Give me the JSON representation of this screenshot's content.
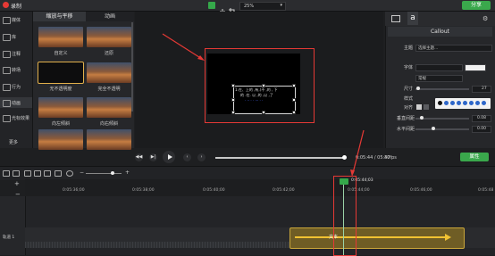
{
  "app": {
    "record_label": "录制",
    "share_label": "分享",
    "zoom": "25%"
  },
  "tools_rail": [
    {
      "label": "媒体",
      "icon": "media-icon"
    },
    {
      "label": "库",
      "icon": "library-icon"
    },
    {
      "label": "注释",
      "icon": "annotation-icon"
    },
    {
      "label": "转场",
      "icon": "transition-icon"
    },
    {
      "label": "行为",
      "icon": "behavior-icon"
    },
    {
      "label": "动画",
      "icon": "animation-icon"
    },
    {
      "label": "光标效果",
      "icon": "cursor-effect-icon"
    },
    {
      "label": "更多",
      "icon": "more-icon"
    }
  ],
  "gallery": {
    "tabs": [
      "缩放与平移",
      "动画"
    ],
    "items": [
      {
        "label": "自定义"
      },
      {
        "label": "还原"
      },
      {
        "label": "无不透明度"
      },
      {
        "label": "完全不透明"
      },
      {
        "label": "向左倾斜"
      },
      {
        "label": "向右倾斜"
      },
      {
        "label": ""
      },
      {
        "label": ""
      }
    ]
  },
  "canvas": {
    "callout_line1": "1.在、上的 ,有,(不 ,的 , 下",
    "callout_line2": "的 .在. 以 ,的 ,以 ,了",
    "callout_line3": "· ·· · · ··· · ·"
  },
  "properties": {
    "title": "Callout",
    "theme_label": "主题",
    "theme_value": "选择主题...",
    "font_label": "字体",
    "font_value": "",
    "weight_value": "常规",
    "size_label": "尺寸",
    "size_value": "27",
    "style_label": "样式",
    "align_label": "对齐",
    "line_spacing_label": "垂直间距",
    "line_spacing_value": "0.08",
    "letter_spacing_label": "水平间距",
    "letter_spacing_value": "0.00"
  },
  "playback": {
    "time": "0:05:44 / 05:47",
    "fps": "30fps",
    "properties_button": "属性"
  },
  "timeline": {
    "ruler_labels": [
      "0:05:36;00",
      "0:05:38;00",
      "0:05:40;00",
      "0:05:42;00",
      "0:05:44;00",
      "0:05:46;00",
      "0:05:48"
    ],
    "playhead_time": "0:05:44;03",
    "track_label": "轨道 1",
    "clip_label": "文本"
  }
}
